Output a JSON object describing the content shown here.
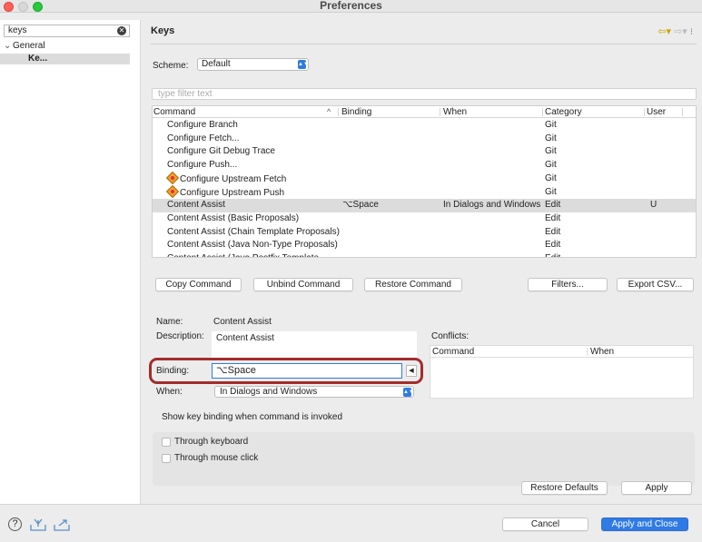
{
  "window": {
    "title": "Preferences"
  },
  "sidebar": {
    "search_value": "keys",
    "tree": {
      "general": "General",
      "keys": "Ke..."
    }
  },
  "header": {
    "title": "Keys"
  },
  "scheme": {
    "label": "Scheme:",
    "value": "Default"
  },
  "filter": {
    "placeholder": "type filter text"
  },
  "table": {
    "columns": [
      "Command",
      "Binding",
      "When",
      "Category",
      "User"
    ],
    "rows": [
      {
        "command": "Configure Branch",
        "binding": "",
        "when": "",
        "category": "Git",
        "user": "",
        "icon": false
      },
      {
        "command": "Configure Fetch...",
        "binding": "",
        "when": "",
        "category": "Git",
        "user": "",
        "icon": false
      },
      {
        "command": "Configure Git Debug Trace",
        "binding": "",
        "when": "",
        "category": "Git",
        "user": "",
        "icon": false
      },
      {
        "command": "Configure Push...",
        "binding": "",
        "when": "",
        "category": "Git",
        "user": "",
        "icon": false
      },
      {
        "command": "Configure Upstream Fetch",
        "binding": "",
        "when": "",
        "category": "Git",
        "user": "",
        "icon": true
      },
      {
        "command": "Configure Upstream Push",
        "binding": "",
        "when": "",
        "category": "Git",
        "user": "",
        "icon": true
      },
      {
        "command": "Content Assist",
        "binding": "⌥Space",
        "when": "In Dialogs and Windows",
        "category": "Edit",
        "user": "U",
        "icon": false,
        "selected": true
      },
      {
        "command": "Content Assist (Basic Proposals)",
        "binding": "",
        "when": "",
        "category": "Edit",
        "user": "",
        "icon": false
      },
      {
        "command": "Content Assist (Chain Template Proposals)",
        "binding": "",
        "when": "",
        "category": "Edit",
        "user": "",
        "icon": false
      },
      {
        "command": "Content Assist (Java Non-Type Proposals)",
        "binding": "",
        "when": "",
        "category": "Edit",
        "user": "",
        "icon": false
      },
      {
        "command": "Content Assist (Java Postfix Template...",
        "binding": "",
        "when": "",
        "category": "Edit",
        "user": "",
        "icon": false
      }
    ]
  },
  "buttons": {
    "copy_command": "Copy Command",
    "unbind_command": "Unbind Command",
    "restore_command": "Restore Command",
    "filters": "Filters...",
    "export_csv": "Export CSV...",
    "restore_defaults": "Restore Defaults",
    "apply": "Apply",
    "cancel": "Cancel",
    "apply_and_close": "Apply and Close"
  },
  "details": {
    "name_label": "Name:",
    "name_value": "Content Assist",
    "description_label": "Description:",
    "description_value": "Content Assist",
    "binding_label": "Binding:",
    "binding_value": "⌥Space",
    "when_label": "When:",
    "when_value": "In Dialogs and Windows",
    "conflicts_label": "Conflicts:",
    "conflicts_columns": [
      "Command",
      "When"
    ]
  },
  "show_binding": {
    "label": "Show key binding when command is invoked",
    "through_keyboard": "Through keyboard",
    "through_mouse": "Through mouse click"
  },
  "colors": {
    "accent": "#2f7ae5",
    "highlight_ring": "#a32c2c",
    "selection": "#dcdcdc"
  }
}
